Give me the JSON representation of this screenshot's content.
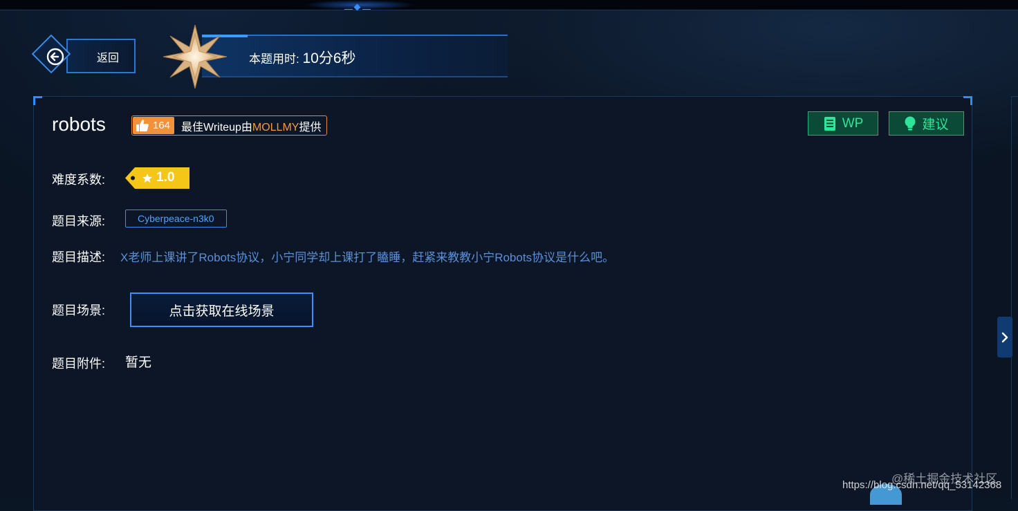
{
  "header": {
    "back_label": "返回",
    "timer_label": "本题用时:",
    "timer_value": "10分6秒"
  },
  "challenge": {
    "title": "robots",
    "likes": "164",
    "writeup_prefix": "最佳Writeup由",
    "writeup_author": "MOLLMY",
    "writeup_suffix": "提供",
    "wp_label": "WP",
    "suggest_label": "建议",
    "difficulty_label": "难度系数:",
    "difficulty_value": "1.0",
    "source_label": "题目来源:",
    "source_value": "Cyberpeace-n3k0",
    "description_label": "题目描述:",
    "description_value": "X老师上课讲了Robots协议，小宁同学却上课打了瞌睡，赶紧来教教小宁Robots协议是什么吧。",
    "scene_label": "题目场景:",
    "scene_button": "点击获取在线场景",
    "attachment_label": "题目附件:",
    "attachment_value": "暂无"
  },
  "watermark": {
    "line1": "@稀土掘金技术社区",
    "line2": "https://blog.csdn.net/qq_53142368"
  },
  "colors": {
    "accent_blue": "#3e8fff",
    "badge_orange": "#f0913c",
    "green_button": "#2ee59a",
    "tag_yellow": "#f5c518",
    "description_blue": "#5b8fd8"
  }
}
